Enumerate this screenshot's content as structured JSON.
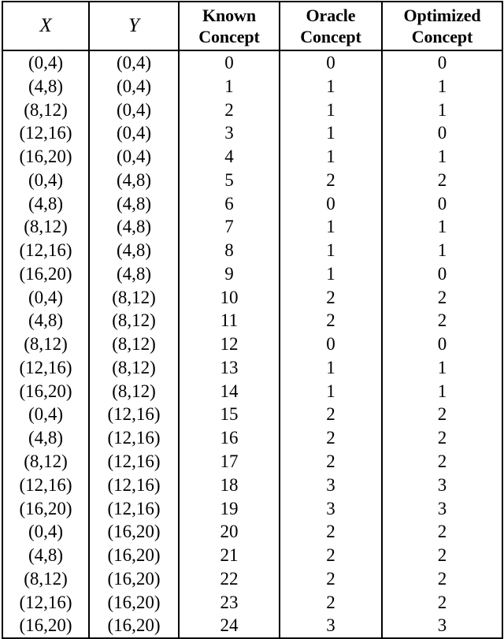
{
  "table": {
    "columns": [
      {
        "key": "x",
        "label": "X",
        "style": "math-italic"
      },
      {
        "key": "y",
        "label": "Y",
        "style": "math-italic"
      },
      {
        "key": "known",
        "label_line1": "Known",
        "label_line2": "Concept",
        "style": "bold"
      },
      {
        "key": "oracle",
        "label_line1": "Oracle",
        "label_line2": "Concept",
        "style": "bold"
      },
      {
        "key": "optimized",
        "label_line1": "Optimized",
        "label_line2": "Concept",
        "style": "bold"
      }
    ],
    "rows": [
      {
        "x": "(0,4)",
        "y": "(0,4)",
        "known": "0",
        "oracle": "0",
        "optimized": "0"
      },
      {
        "x": "(4,8)",
        "y": "(0,4)",
        "known": "1",
        "oracle": "1",
        "optimized": "1"
      },
      {
        "x": "(8,12)",
        "y": "(0,4)",
        "known": "2",
        "oracle": "1",
        "optimized": "1"
      },
      {
        "x": "(12,16)",
        "y": "(0,4)",
        "known": "3",
        "oracle": "1",
        "optimized": "0"
      },
      {
        "x": "(16,20)",
        "y": "(0,4)",
        "known": "4",
        "oracle": "1",
        "optimized": "1"
      },
      {
        "x": "(0,4)",
        "y": "(4,8)",
        "known": "5",
        "oracle": "2",
        "optimized": "2"
      },
      {
        "x": "(4,8)",
        "y": "(4,8)",
        "known": "6",
        "oracle": "0",
        "optimized": "0"
      },
      {
        "x": "(8,12)",
        "y": "(4,8)",
        "known": "7",
        "oracle": "1",
        "optimized": "1"
      },
      {
        "x": "(12,16)",
        "y": "(4,8)",
        "known": "8",
        "oracle": "1",
        "optimized": "1"
      },
      {
        "x": "(16,20)",
        "y": "(4,8)",
        "known": "9",
        "oracle": "1",
        "optimized": "0"
      },
      {
        "x": "(0,4)",
        "y": "(8,12)",
        "known": "10",
        "oracle": "2",
        "optimized": "2"
      },
      {
        "x": "(4,8)",
        "y": "(8,12)",
        "known": "11",
        "oracle": "2",
        "optimized": "2"
      },
      {
        "x": "(8,12)",
        "y": "(8,12)",
        "known": "12",
        "oracle": "0",
        "optimized": "0"
      },
      {
        "x": "(12,16)",
        "y": "(8,12)",
        "known": "13",
        "oracle": "1",
        "optimized": "1"
      },
      {
        "x": "(16,20)",
        "y": "(8,12)",
        "known": "14",
        "oracle": "1",
        "optimized": "1"
      },
      {
        "x": "(0,4)",
        "y": "(12,16)",
        "known": "15",
        "oracle": "2",
        "optimized": "2"
      },
      {
        "x": "(4,8)",
        "y": "(12,16)",
        "known": "16",
        "oracle": "2",
        "optimized": "2"
      },
      {
        "x": "(8,12)",
        "y": "(12,16)",
        "known": "17",
        "oracle": "2",
        "optimized": "2"
      },
      {
        "x": "(12,16)",
        "y": "(12,16)",
        "known": "18",
        "oracle": "3",
        "optimized": "3"
      },
      {
        "x": "(16,20)",
        "y": "(12,16)",
        "known": "19",
        "oracle": "3",
        "optimized": "3"
      },
      {
        "x": "(0,4)",
        "y": "(16,20)",
        "known": "20",
        "oracle": "2",
        "optimized": "2"
      },
      {
        "x": "(4,8)",
        "y": "(16,20)",
        "known": "21",
        "oracle": "2",
        "optimized": "2"
      },
      {
        "x": "(8,12)",
        "y": "(16,20)",
        "known": "22",
        "oracle": "2",
        "optimized": "2"
      },
      {
        "x": "(12,16)",
        "y": "(16,20)",
        "known": "23",
        "oracle": "2",
        "optimized": "2"
      },
      {
        "x": "(16,20)",
        "y": "(16,20)",
        "known": "24",
        "oracle": "3",
        "optimized": "3"
      }
    ]
  },
  "colors": {
    "rule": "#000000",
    "text": "#000000",
    "background": "#ffffff"
  }
}
